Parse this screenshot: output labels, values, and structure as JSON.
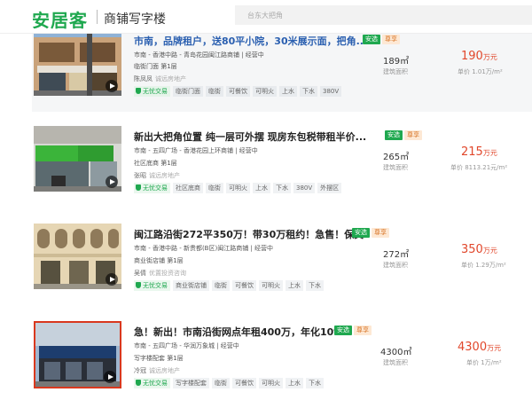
{
  "header": {
    "logo": "安居客",
    "subtitle": "商铺写字楼",
    "search_placeholder": "台东大把角"
  },
  "listings": [
    {
      "title": "市南，品牌租户，送80平小院，30米展示面，把角...",
      "tags": [
        "安选",
        "尊享"
      ],
      "location": "市南 - 香港中路 - 青岛花园闽江路商铺 | 经营中",
      "floor": "临街门面 第1层",
      "agent": "陈凤凤",
      "company": "诚远房地产",
      "features": [
        "无忧交易",
        "临街门面",
        "临街",
        "可餐饮",
        "可明火",
        "上水",
        "下水",
        "380V"
      ],
      "area": "189㎡",
      "area_label": "建筑面积",
      "price": "190",
      "price_unit": "万元",
      "unit_price": "单价 1.01万/m²"
    },
    {
      "title": "新出大把角位置 纯一层可外摆 现房东包税带租半价...",
      "tags": [
        "安选",
        "尊享"
      ],
      "location": "市南 - 五四广场 - 香港花园上环商铺 | 经营中",
      "floor": "社区底商 第1层",
      "agent": "张昭",
      "company": "诚远房地产",
      "features": [
        "无忧交易",
        "社区底商",
        "临街",
        "可明火",
        "上水",
        "下水",
        "380V",
        "外摆区"
      ],
      "area": "265㎡",
      "area_label": "建筑面积",
      "price": "215",
      "price_unit": "万元",
      "unit_price": "单价 8113.21元/m²"
    },
    {
      "title": "闽江路沿街272平350万！带30万租约！急售！保真",
      "tags": [
        "安选",
        "尊享"
      ],
      "location": "市南 - 香港中路 - 新贵都(B区)闽江路商铺 | 经营中",
      "floor": "商业街店铺 第1层",
      "agent": "吴倩",
      "company": "优置投资咨询",
      "features": [
        "无忧交易",
        "商业街店铺",
        "临街",
        "可餐饮",
        "可明火",
        "上水",
        "下水"
      ],
      "area": "272㎡",
      "area_label": "建筑面积",
      "price": "350",
      "price_unit": "万元",
      "unit_price": "单价 1.29万/m²"
    },
    {
      "title": "急！新出！市南沿街网点年租400万，年化10%",
      "tags": [
        "安选",
        "尊享"
      ],
      "location": "市南 - 五四广场 - 华润万象城 | 经营中",
      "floor": "写字楼配套 第1层",
      "agent": "冷冠",
      "company": "诚远房地产",
      "features": [
        "无忧交易",
        "写字楼配套",
        "临街",
        "可餐饮",
        "可明火",
        "上水",
        "下水"
      ],
      "area": "4300㎡",
      "area_label": "建筑面积",
      "price": "4300",
      "price_unit": "万元",
      "unit_price": "单价 1万/m²"
    }
  ],
  "colors": {
    "brand_green": "#1fa84f",
    "price_red": "#e1472b",
    "title_blue": "#2a5fb0",
    "tag_orange": "#fde8d4"
  }
}
